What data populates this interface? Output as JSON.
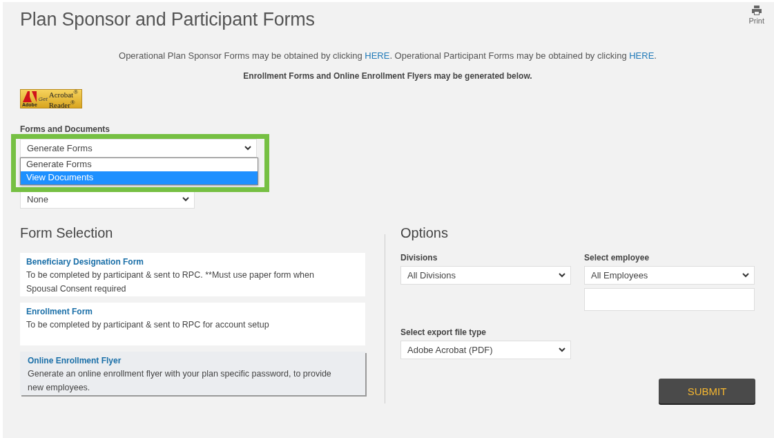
{
  "title": "Plan Sponsor and Participant Forms",
  "print": {
    "label": "Print"
  },
  "info": [
    {
      "kind": "text",
      "text": "Operational Plan Sponsor Forms may be obtained by clicking "
    },
    {
      "kind": "link",
      "text": "HERE"
    },
    {
      "kind": "text",
      "text": ". Operational Participant Forms may be obtained by clicking "
    },
    {
      "kind": "link",
      "text": "HERE"
    },
    {
      "kind": "text",
      "text": "."
    }
  ],
  "note": "Enrollment Forms and Online Enrollment Flyers may be generated below.",
  "acrobat_badge": {
    "brand": "Adobe",
    "get": "Get",
    "line1": "Acrobat$^{®}$",
    "line2": "Reader$^{®}$"
  },
  "forms_and_documents": {
    "label": "Forms and Documents",
    "value": "Generate Forms",
    "expanded": true,
    "highlighted": true,
    "options": [
      {
        "label": "Generate Forms",
        "highlighted": false
      },
      {
        "label": "View Documents",
        "highlighted": true
      }
    ]
  },
  "secondary_select": {
    "value": "None"
  },
  "form_selection": {
    "heading": "Form Selection",
    "items": [
      {
        "title": "Beneficiary Designation Form",
        "description": "To be completed by participant & sent to RPC. **Must use paper form when Spousal Consent required",
        "selected": false
      },
      {
        "title": "Enrollment Form",
        "description": "To be completed by participant & sent to RPC for account setup",
        "selected": false
      },
      {
        "title": "Online Enrollment Flyer",
        "description": "Generate an online enrollment flyer with your plan specific password, to provide new employees.",
        "selected": true
      }
    ]
  },
  "options": {
    "heading": "Options",
    "divisions": {
      "label": "Divisions",
      "value": "All Divisions"
    },
    "employee": {
      "label": "Select employee",
      "value": "All Employees"
    },
    "export": {
      "label": "Select export file type",
      "value": "Adobe Acrobat (PDF)"
    },
    "submit": "SUBMIT"
  }
}
